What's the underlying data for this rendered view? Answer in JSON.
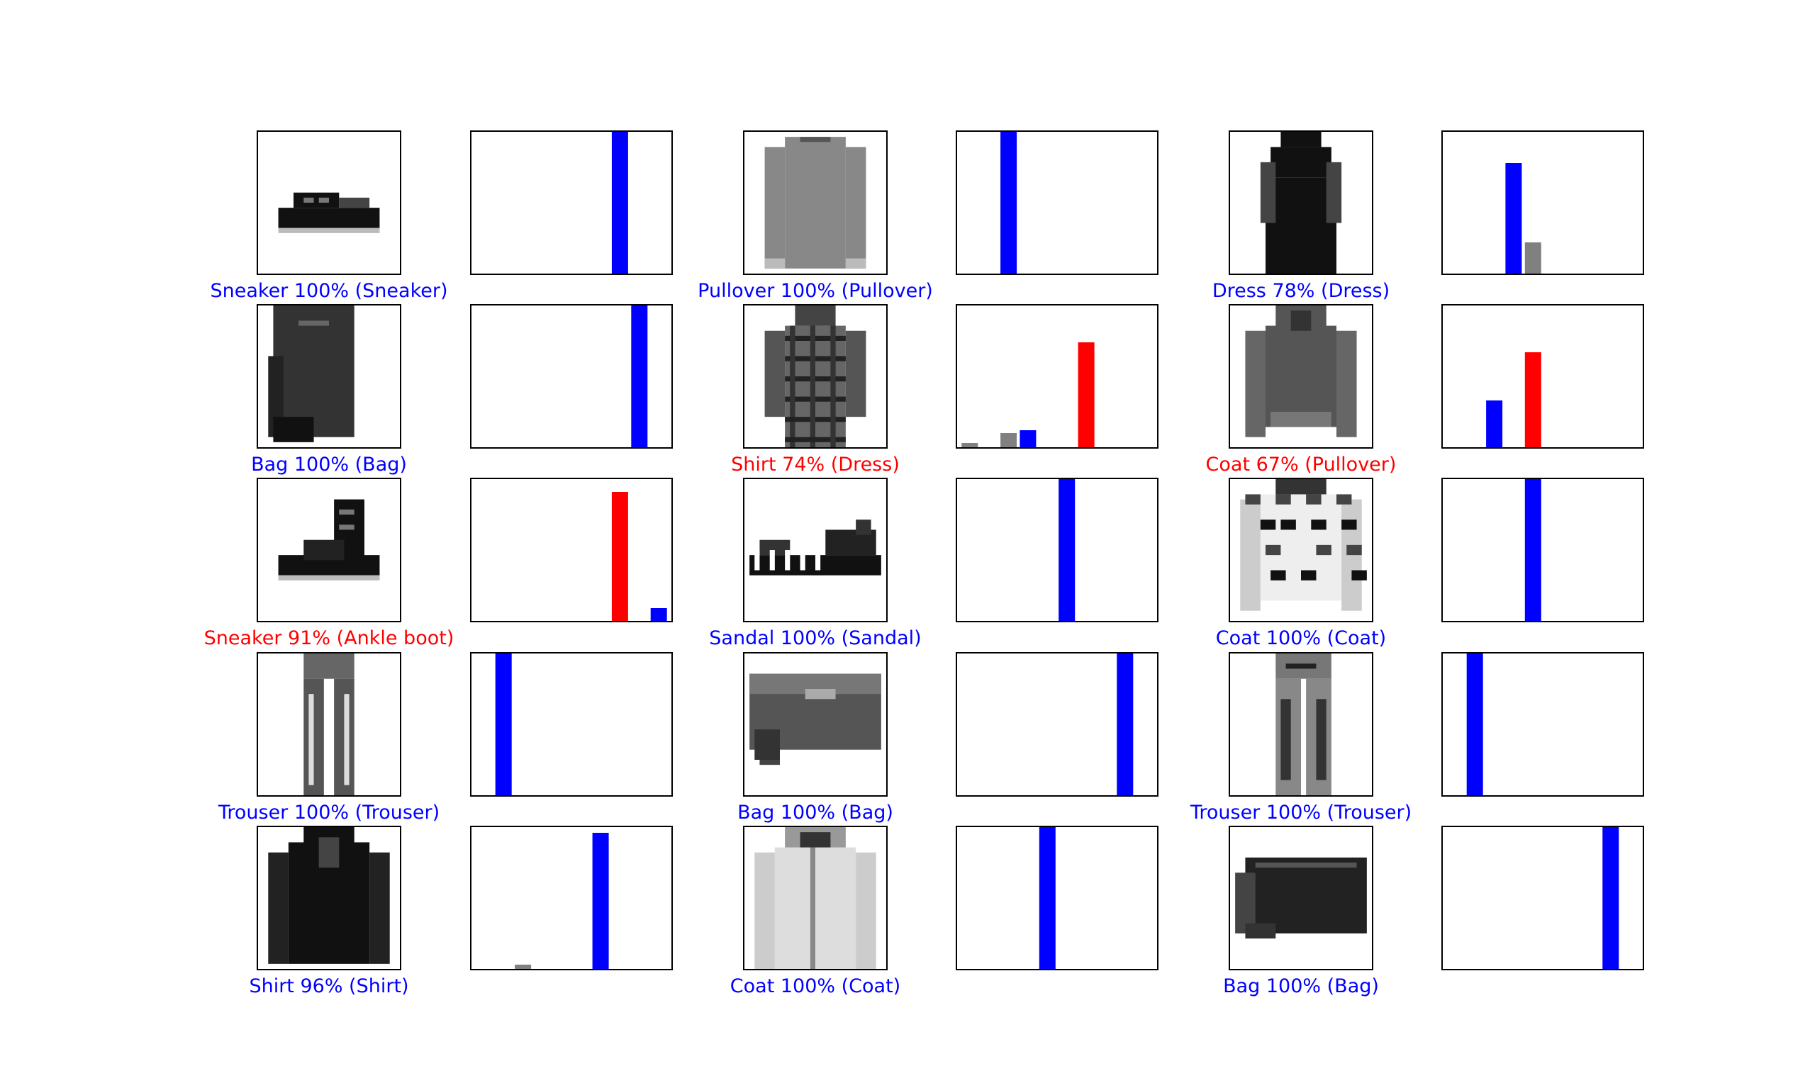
{
  "colors": {
    "correct": "#0000ff",
    "wrong": "#ff0000",
    "other": "#808080",
    "frame": "#000000"
  },
  "chart_data": {
    "type": "bar",
    "categories": [
      "0",
      "1",
      "2",
      "3",
      "4",
      "5",
      "6",
      "7",
      "8",
      "9"
    ],
    "ylim": [
      0,
      1
    ],
    "grid": false,
    "legend": "none",
    "panels": [
      {
        "image": "sneaker-image",
        "caption": "Sneaker 100% (Sneaker)",
        "predicted": "Sneaker",
        "confidence": 100,
        "true_label": "Sneaker",
        "correct": true,
        "predicted_index": 7,
        "true_index": 7,
        "values": [
          0,
          0,
          0,
          0,
          0,
          0,
          0,
          1.0,
          0,
          0
        ]
      },
      {
        "image": "pullover-image",
        "caption": "Pullover 100% (Pullover)",
        "predicted": "Pullover",
        "confidence": 100,
        "true_label": "Pullover",
        "correct": true,
        "predicted_index": 2,
        "true_index": 2,
        "values": [
          0,
          0,
          1.0,
          0,
          0,
          0,
          0,
          0,
          0,
          0
        ]
      },
      {
        "image": "dress-image",
        "caption": "Dress 78% (Dress)",
        "predicted": "Dress",
        "confidence": 78,
        "true_label": "Dress",
        "correct": true,
        "predicted_index": 3,
        "true_index": 3,
        "values": [
          0,
          0,
          0,
          0.78,
          0.22,
          0,
          0,
          0,
          0,
          0
        ]
      },
      {
        "image": "bag-image-1",
        "caption": "Bag 100% (Bag)",
        "predicted": "Bag",
        "confidence": 100,
        "true_label": "Bag",
        "correct": true,
        "predicted_index": 8,
        "true_index": 8,
        "values": [
          0,
          0,
          0,
          0,
          0,
          0,
          0,
          0,
          1.0,
          0
        ]
      },
      {
        "image": "dress-plaid-image",
        "caption": "Shirt 74% (Dress)",
        "predicted": "Shirt",
        "confidence": 74,
        "true_label": "Dress",
        "correct": false,
        "predicted_index": 6,
        "true_index": 3,
        "values": [
          0.03,
          0,
          0.1,
          0.12,
          0,
          0,
          0.74,
          0,
          0,
          0
        ]
      },
      {
        "image": "hoodie-image",
        "caption": "Coat 67% (Pullover)",
        "predicted": "Coat",
        "confidence": 67,
        "true_label": "Pullover",
        "correct": false,
        "predicted_index": 4,
        "true_index": 2,
        "values": [
          0,
          0,
          0.33,
          0,
          0.67,
          0,
          0,
          0,
          0,
          0
        ]
      },
      {
        "image": "ankle-boot-image",
        "caption": "Sneaker 91% (Ankle boot)",
        "predicted": "Sneaker",
        "confidence": 91,
        "true_label": "Ankle boot",
        "correct": false,
        "predicted_index": 7,
        "true_index": 9,
        "values": [
          0,
          0,
          0,
          0,
          0,
          0,
          0,
          0.91,
          0,
          0.09
        ]
      },
      {
        "image": "sandal-image",
        "caption": "Sandal 100% (Sandal)",
        "predicted": "Sandal",
        "confidence": 100,
        "true_label": "Sandal",
        "correct": true,
        "predicted_index": 5,
        "true_index": 5,
        "values": [
          0,
          0,
          0,
          0,
          0,
          1.0,
          0,
          0,
          0,
          0
        ]
      },
      {
        "image": "coat-pattern-image",
        "caption": "Coat 100% (Coat)",
        "predicted": "Coat",
        "confidence": 100,
        "true_label": "Coat",
        "correct": true,
        "predicted_index": 4,
        "true_index": 4,
        "values": [
          0,
          0,
          0,
          0,
          1.0,
          0,
          0,
          0,
          0,
          0
        ]
      },
      {
        "image": "trouser-image-1",
        "caption": "Trouser 100% (Trouser)",
        "predicted": "Trouser",
        "confidence": 100,
        "true_label": "Trouser",
        "correct": true,
        "predicted_index": 1,
        "true_index": 1,
        "values": [
          0,
          1.0,
          0,
          0,
          0,
          0,
          0,
          0,
          0,
          0
        ]
      },
      {
        "image": "bag-image-2",
        "caption": "Bag 100% (Bag)",
        "predicted": "Bag",
        "confidence": 100,
        "true_label": "Bag",
        "correct": true,
        "predicted_index": 8,
        "true_index": 8,
        "values": [
          0,
          0,
          0,
          0,
          0,
          0,
          0,
          0,
          1.0,
          0
        ]
      },
      {
        "image": "trouser-image-2",
        "caption": "Trouser 100% (Trouser)",
        "predicted": "Trouser",
        "confidence": 100,
        "true_label": "Trouser",
        "correct": true,
        "predicted_index": 1,
        "true_index": 1,
        "values": [
          0,
          1.0,
          0,
          0,
          0,
          0,
          0,
          0,
          0,
          0
        ]
      },
      {
        "image": "shirt-image",
        "caption": "Shirt 96% (Shirt)",
        "predicted": "Shirt",
        "confidence": 96,
        "true_label": "Shirt",
        "correct": true,
        "predicted_index": 6,
        "true_index": 6,
        "values": [
          0,
          0,
          0.03,
          0,
          0,
          0,
          0.96,
          0,
          0,
          0
        ]
      },
      {
        "image": "coat-white-image",
        "caption": "Coat 100% (Coat)",
        "predicted": "Coat",
        "confidence": 100,
        "true_label": "Coat",
        "correct": true,
        "predicted_index": 4,
        "true_index": 4,
        "values": [
          0,
          0,
          0,
          0,
          1.0,
          0,
          0,
          0,
          0,
          0
        ]
      },
      {
        "image": "bag-image-3",
        "caption": "Bag 100% (Bag)",
        "predicted": "Bag",
        "confidence": 100,
        "true_label": "Bag",
        "correct": true,
        "predicted_index": 8,
        "true_index": 8,
        "values": [
          0,
          0,
          0,
          0,
          0,
          0,
          0,
          0,
          1.0,
          0
        ]
      }
    ]
  }
}
